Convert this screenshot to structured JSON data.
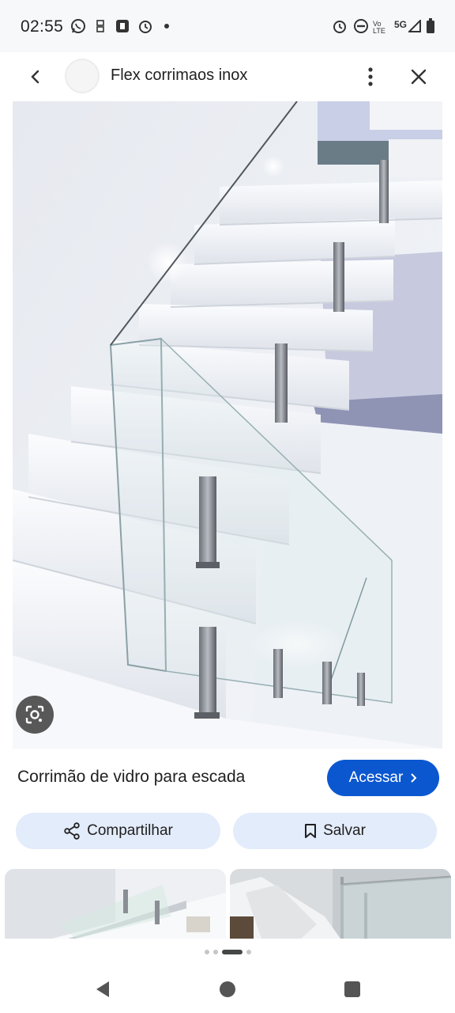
{
  "status_bar": {
    "time": "02:55",
    "network_label": "5G",
    "volte_label": "Vo LTE"
  },
  "header": {
    "title": "Flex corrimaos inox"
  },
  "image": {
    "description_icon": "camera-lens-icon"
  },
  "caption": {
    "text": "Corrimão de vidro para escada"
  },
  "actions": {
    "visit_label": "Acessar",
    "share_label": "Compartilhar",
    "save_label": "Salvar"
  },
  "pager": {
    "count": 4,
    "active_index": 2
  },
  "colors": {
    "accent": "#0b57d0",
    "pill_bg": "#e3ecfa",
    "status_bg": "#f7f8fa"
  }
}
